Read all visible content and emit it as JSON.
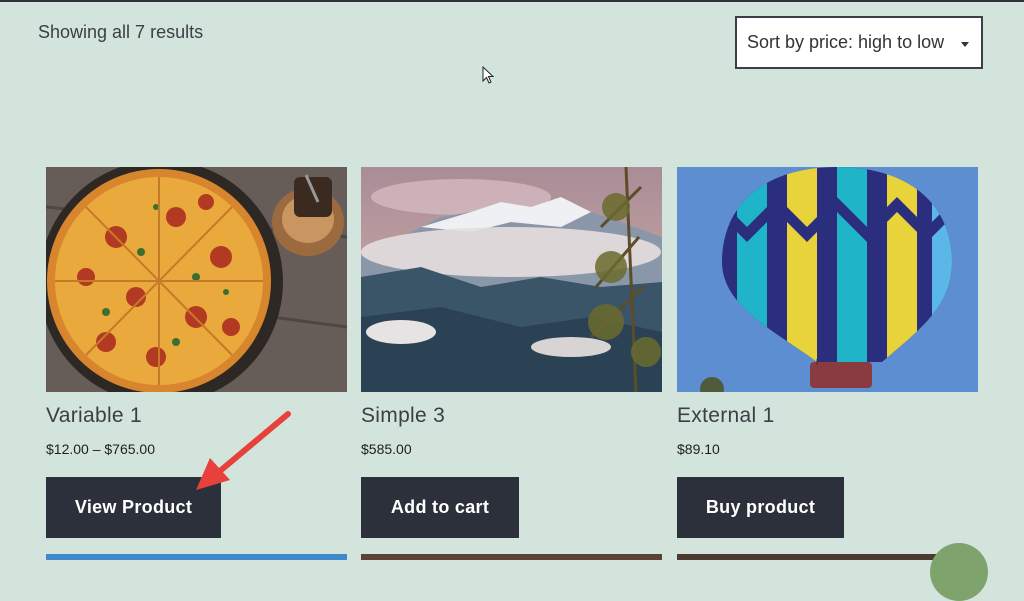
{
  "toolbar": {
    "result_count": "Showing all 7 results",
    "sort_selected": "Sort by price: high to low"
  },
  "products": [
    {
      "title": "Variable 1",
      "price": "$12.00 – $765.00",
      "button": "View Product",
      "image": "pizza"
    },
    {
      "title": "Simple 3",
      "price": "$585.00",
      "button": "Add to cart",
      "image": "mountains"
    },
    {
      "title": "External 1",
      "price": "$89.10",
      "button": "Buy product",
      "image": "hot-air-balloon"
    }
  ],
  "colors": {
    "background": "#d3e4dc",
    "button": "#2b303a",
    "annotation_arrow": "#e8413c",
    "fab": "#7fa36d"
  },
  "icons": [
    "caret-down-icon",
    "mouse-cursor-icon",
    "annotation-arrow-icon"
  ]
}
